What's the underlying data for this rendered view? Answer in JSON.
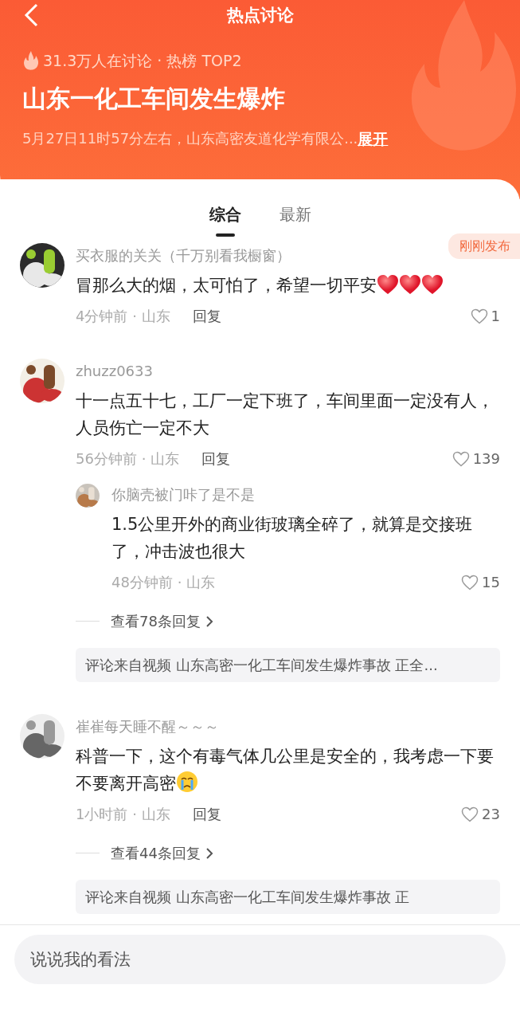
{
  "header": {
    "title": "热点讨论",
    "stats": "31.3万人在讨论 · 热榜 TOP2",
    "topic": "山东一化工车间发生爆炸",
    "summary": "5月27日11时57分左右，山东高密友道化学有限公...",
    "expand": "展开"
  },
  "tabs": [
    {
      "label": "综合",
      "selected": true
    },
    {
      "label": "最新",
      "selected": false
    }
  ],
  "comments": [
    {
      "user": "买衣服的关关（千万别看我橱窗）",
      "badge": "刚刚发布",
      "text": "冒那么大的烟，太可怕了，希望一切平安",
      "emojis": [
        {
          "kind": "heart"
        },
        {
          "kind": "heart"
        },
        {
          "kind": "heart"
        }
      ],
      "meta": "4分钟前 · 山东",
      "reply": "回复",
      "likes": "1"
    },
    {
      "user": "zhuzz0633",
      "text": "十一点五十七，工厂一定下班了，车间里面一定没有人，人员伤亡一定不大",
      "meta": "56分钟前 · 山东",
      "reply": "回复",
      "likes": "139",
      "replies": [
        {
          "user": "你脑壳被门咔了是不是",
          "text": "1.5公里开外的商业街玻璃全碎了，就算是交接班了，冲击波也很大",
          "meta": "48分钟前 · 山东",
          "likes": "15"
        }
      ],
      "view_more": "查看78条回复",
      "source": "评论来自视频 山东高密一化工车间发生爆炸事故 正全..."
    },
    {
      "user": "崔崔每天睡不醒～～～",
      "text": "科普一下，这个有毒气体几公里是安全的，我考虑一下要不要离开高密",
      "emojis": [
        {
          "kind": "crying"
        }
      ],
      "meta": "1小时前 · 山东",
      "reply": "回复",
      "likes": "23",
      "view_more": "查看44条回复",
      "source": "评论来自视频 山东高密一化工车间发生爆炸事故 正"
    }
  ],
  "composer": {
    "placeholder": "说说我的看法"
  }
}
